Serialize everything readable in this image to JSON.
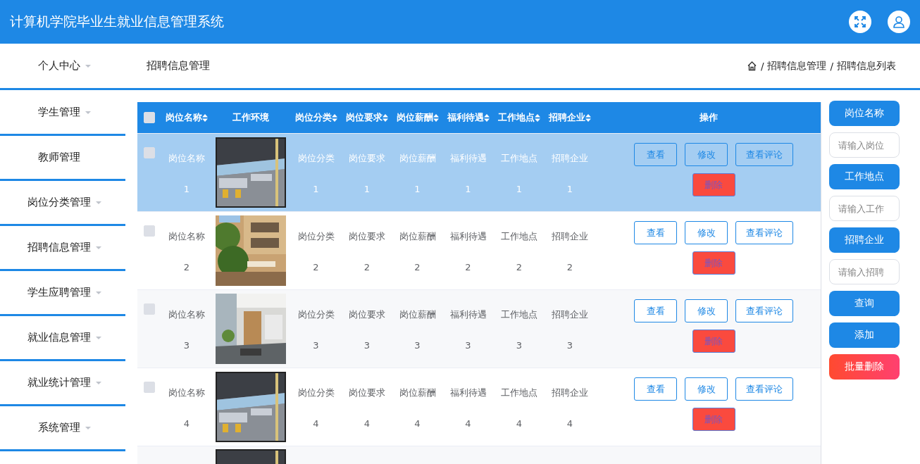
{
  "header": {
    "title": "计算机学院毕业生就业信息管理系统"
  },
  "nav": {
    "user_menu": {
      "label": "个人中心",
      "has_submenu": true
    },
    "page_title": "招聘信息管理",
    "breadcrumb": [
      {
        "separator": "/",
        "label": "招聘信息管理"
      },
      {
        "separator": "/",
        "label": "招聘信息列表"
      }
    ]
  },
  "sidebar": {
    "items": [
      {
        "label": "学生管理",
        "has_submenu": true
      },
      {
        "label": "教师管理",
        "has_submenu": false
      },
      {
        "label": "岗位分类管理",
        "has_submenu": true
      },
      {
        "label": "招聘信息管理",
        "has_submenu": true
      },
      {
        "label": "学生应聘管理",
        "has_submenu": true
      },
      {
        "label": "就业信息管理",
        "has_submenu": true
      },
      {
        "label": "就业统计管理",
        "has_submenu": true
      },
      {
        "label": "系统管理",
        "has_submenu": true
      }
    ]
  },
  "table": {
    "header_checked": false,
    "columns": [
      {
        "label": "岗位名称",
        "sortable": true
      },
      {
        "label": "工作环境",
        "sortable": false
      },
      {
        "label": "岗位分类",
        "sortable": true
      },
      {
        "label": "岗位要求",
        "sortable": true
      },
      {
        "label": "岗位薪酬",
        "sortable": true
      },
      {
        "label": "福利待遇",
        "sortable": true
      },
      {
        "label": "工作地点",
        "sortable": true
      },
      {
        "label": "招聘企业",
        "sortable": true
      },
      {
        "label": "操作",
        "sortable": false
      }
    ],
    "rows": [
      {
        "selected": true,
        "checked": false,
        "cells": [
          "岗位名称1",
          "",
          "岗位分类1",
          "岗位要求1",
          "岗位薪酬1",
          "福利待遇1",
          "工作地点1",
          "招聘企业1"
        ],
        "actions": [
          {
            "label": "查看",
            "kind": "plain"
          },
          {
            "label": "修改",
            "kind": "plain"
          },
          {
            "label": "查看评论",
            "kind": "plain"
          },
          {
            "label": "删除",
            "kind": "danger"
          }
        ]
      },
      {
        "selected": false,
        "checked": false,
        "cells": [
          "岗位名称2",
          "",
          "岗位分类2",
          "岗位要求2",
          "岗位薪酬2",
          "福利待遇2",
          "工作地点2",
          "招聘企业2"
        ],
        "actions": [
          {
            "label": "查看",
            "kind": "plain"
          },
          {
            "label": "修改",
            "kind": "plain"
          },
          {
            "label": "查看评论",
            "kind": "plain"
          },
          {
            "label": "删除",
            "kind": "danger"
          }
        ]
      },
      {
        "selected": false,
        "checked": false,
        "cells": [
          "岗位名称3",
          "",
          "岗位分类3",
          "岗位要求3",
          "岗位薪酬3",
          "福利待遇3",
          "工作地点3",
          "招聘企业3"
        ],
        "actions": [
          {
            "label": "查看",
            "kind": "plain"
          },
          {
            "label": "修改",
            "kind": "plain"
          },
          {
            "label": "查看评论",
            "kind": "plain"
          },
          {
            "label": "删除",
            "kind": "danger"
          }
        ]
      },
      {
        "selected": false,
        "checked": false,
        "cells": [
          "岗位名称4",
          "",
          "岗位分类4",
          "岗位要求4",
          "岗位薪酬4",
          "福利待遇4",
          "工作地点4",
          "招聘企业4"
        ],
        "actions": [
          {
            "label": "查看",
            "kind": "plain"
          },
          {
            "label": "修改",
            "kind": "plain"
          },
          {
            "label": "查看评论",
            "kind": "plain"
          },
          {
            "label": "删除",
            "kind": "danger"
          }
        ]
      }
    ]
  },
  "search_panel": {
    "items": [
      {
        "kind": "label",
        "text": "岗位名称"
      },
      {
        "kind": "input",
        "placeholder": "请输入岗位"
      },
      {
        "kind": "label",
        "text": "工作地点"
      },
      {
        "kind": "input",
        "placeholder": "请输入工作"
      },
      {
        "kind": "label",
        "text": "招聘企业"
      },
      {
        "kind": "input",
        "placeholder": "请输入招聘"
      },
      {
        "kind": "button",
        "text": "查询"
      },
      {
        "kind": "button",
        "text": "添加"
      },
      {
        "kind": "danger",
        "text": "批量删除"
      }
    ]
  }
}
